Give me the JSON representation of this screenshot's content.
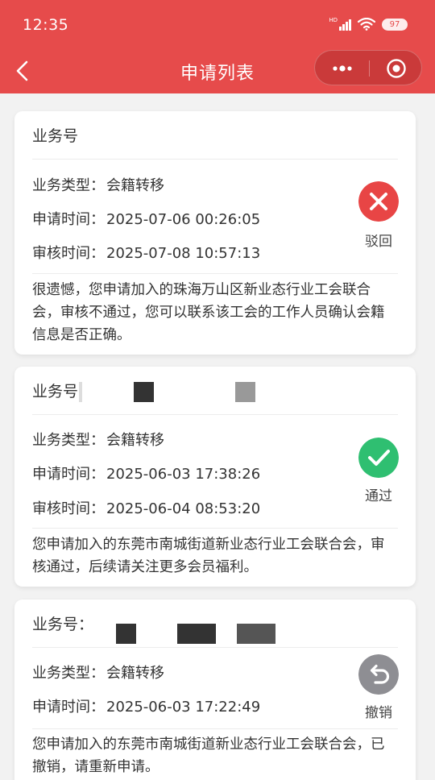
{
  "status_bar": {
    "time": "12:35",
    "network": "HD",
    "battery": "97"
  },
  "nav": {
    "title": "申请列表"
  },
  "labels": {
    "business_no": "业务号",
    "business_no_colon": "业务号：",
    "type": "业务类型：",
    "apply_time": "申请时间：",
    "review_time": "审核时间："
  },
  "cards": [
    {
      "type_value": "会籍转移",
      "apply_time": "2025-07-06 00:26:05",
      "review_time": "2025-07-08 10:57:13",
      "status": "驳回",
      "status_color": "#e84545",
      "status_icon": "close-icon",
      "message": "很遗憾，您申请加入的珠海万山区新业态行业工会联合会，审核不通过，您可以联系该工会的工作人员确认会籍信息是否正确。"
    },
    {
      "type_value": "会籍转移",
      "apply_time": "2025-06-03 17:38:26",
      "review_time": "2025-06-04 08:53:20",
      "status": "通过",
      "status_color": "#2fbf71",
      "status_icon": "check-icon",
      "message": "您申请加入的东莞市南城街道新业态行业工会联合会，审核通过，后续请关注更多会员福利。"
    },
    {
      "type_value": "会籍转移",
      "apply_time": "2025-06-03 17:22:49",
      "status": "撤销",
      "status_color": "#8e8e93",
      "status_icon": "undo-icon",
      "message": "您申请加入的东莞市南城街道新业态行业工会联合会，已撤销，请重新申请。"
    }
  ]
}
